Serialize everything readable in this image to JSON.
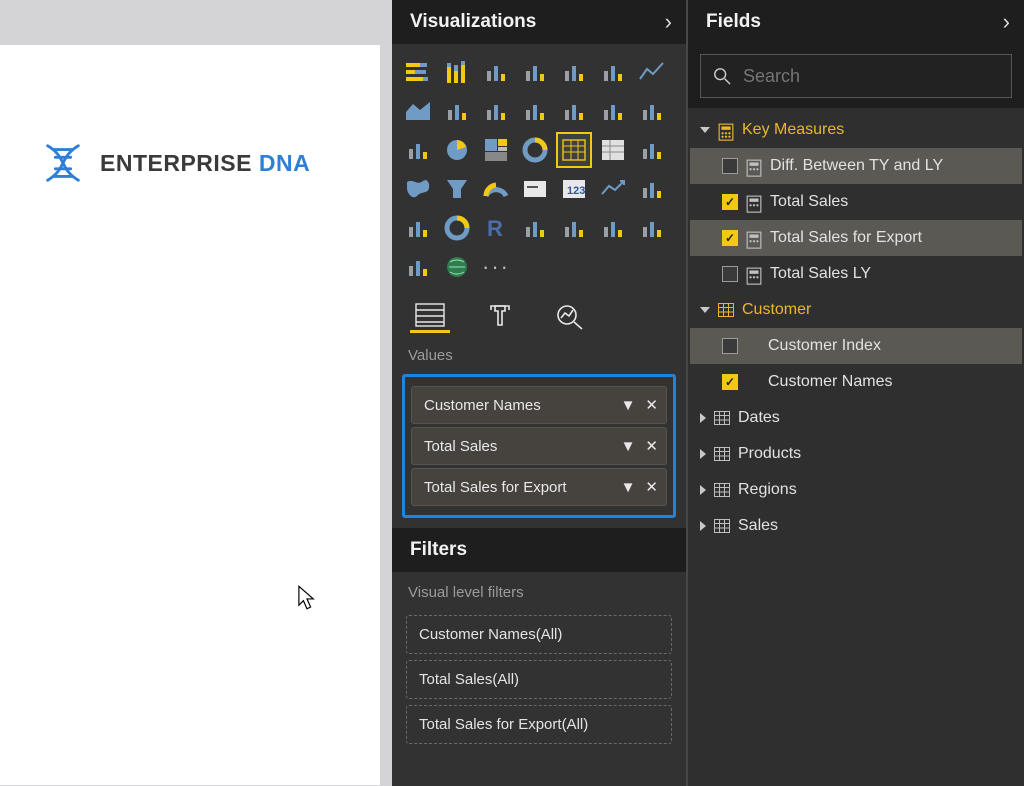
{
  "canvas": {
    "logo_word1": "ENTERPRISE",
    "logo_word2": "DNA"
  },
  "visualizations": {
    "title": "Visualizations",
    "values_label": "Values",
    "value_fields": [
      {
        "label": "Customer Names"
      },
      {
        "label": "Total Sales"
      },
      {
        "label": "Total Sales for Export"
      }
    ],
    "filters_title": "Filters",
    "visual_filters_label": "Visual level filters",
    "visual_filters": [
      {
        "label": "Customer Names(All)"
      },
      {
        "label": "Total Sales(All)"
      },
      {
        "label": "Total Sales for Export(All)"
      }
    ],
    "viz_icons": [
      "stacked-bar",
      "stacked-column",
      "clustered-bar",
      "clustered-column",
      "100-stacked-bar",
      "100-stacked-column",
      "line",
      "area",
      "stacked-area",
      "line-stacked-column",
      "line-clustered-column",
      "ribbon",
      "waterfall",
      "scatter",
      "scatter-small",
      "pie",
      "treemap",
      "donut",
      "table",
      "matrix",
      "blank",
      "map",
      "funnel",
      "gauge",
      "card",
      "multi-row-card",
      "kpi",
      "slicer",
      "arcgis",
      "donut2",
      "r-visual",
      "python-visual",
      "key-influencers",
      "custom-visual",
      "blank2",
      "paginated",
      "globe",
      "more"
    ]
  },
  "fields": {
    "title": "Fields",
    "search_placeholder": "Search",
    "groups": [
      {
        "name": "Key Measures",
        "expanded": true,
        "icon": "calculator",
        "items": [
          {
            "label": "Diff. Between TY and LY",
            "checked": false,
            "icon": "measure"
          },
          {
            "label": "Total Sales",
            "checked": true,
            "icon": "measure"
          },
          {
            "label": "Total Sales for Export",
            "checked": true,
            "icon": "measure"
          },
          {
            "label": "Total Sales LY",
            "checked": false,
            "icon": "measure"
          }
        ]
      },
      {
        "name": "Customer",
        "expanded": true,
        "icon": "table",
        "items": [
          {
            "label": "Customer Index",
            "checked": false,
            "icon": "none"
          },
          {
            "label": "Customer Names",
            "checked": true,
            "icon": "none"
          }
        ]
      },
      {
        "name": "Dates",
        "expanded": false,
        "icon": "table",
        "items": []
      },
      {
        "name": "Products",
        "expanded": false,
        "icon": "table",
        "items": []
      },
      {
        "name": "Regions",
        "expanded": false,
        "icon": "table",
        "items": []
      },
      {
        "name": "Sales",
        "expanded": false,
        "icon": "table",
        "items": []
      }
    ]
  }
}
